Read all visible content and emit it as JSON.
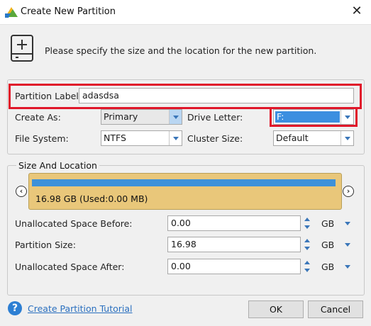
{
  "window": {
    "title": "Create New Partition",
    "close_glyph": "✕"
  },
  "header": {
    "text": "Please specify the size and the location for the new partition."
  },
  "form": {
    "partition_label": {
      "label": "Partition Label:",
      "value": "adasdsa"
    },
    "create_as": {
      "label": "Create As:",
      "value": "Primary"
    },
    "drive_letter": {
      "label": "Drive Letter:",
      "value": "F:"
    },
    "file_system": {
      "label": "File System:",
      "value": "NTFS"
    },
    "cluster_size": {
      "label": "Cluster Size:",
      "value": "Default"
    }
  },
  "size_location": {
    "title": "Size And Location",
    "partition_info": "16.98 GB (Used:0.00 MB)",
    "partition_used_fraction": 0,
    "fields": [
      {
        "label": "Unallocated Space Before:",
        "value": "0.00",
        "unit": "GB"
      },
      {
        "label": "Partition Size:",
        "value": "16.98",
        "unit": "GB"
      },
      {
        "label": "Unallocated Space After:",
        "value": "0.00",
        "unit": "GB"
      }
    ]
  },
  "footer": {
    "tutorial_link": "Create Partition Tutorial",
    "help_glyph": "?",
    "ok_label": "OK",
    "cancel_label": "Cancel"
  },
  "icons": {
    "app": "app-logo-icon",
    "disk": "add-disk-icon",
    "nav_left": "chevron-left-icon",
    "nav_right": "chevron-right-icon"
  },
  "colors": {
    "highlight": "#e0172a",
    "partition_block": "#e9c77a",
    "partition_bar": "#3d91d9",
    "selection": "#3c8fe0",
    "link": "#2a6fbf"
  }
}
